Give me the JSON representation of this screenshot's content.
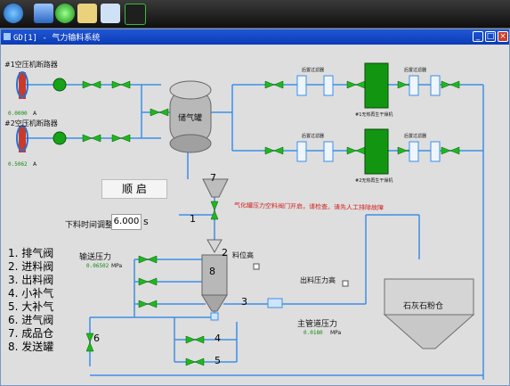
{
  "window": {
    "title": "GD[1] - 气力输料系统"
  },
  "compressors": [
    {
      "name": "#1空压机断路器",
      "value": "0.0000",
      "unit": "A"
    },
    {
      "name": "#2空压机断路器",
      "value": "0.5062",
      "unit": "A"
    }
  ],
  "tank_label": "储气罐",
  "filters": [
    "后置过滤器",
    "后置过滤器",
    "后置过滤器",
    "后置过滤器"
  ],
  "dryers": [
    "#1无热再生干燥机",
    "#2无热再生干燥机"
  ],
  "mode_button": "顺  启",
  "unload_time": {
    "label": "下料时间调整",
    "value": "6.000",
    "unit": "s"
  },
  "alarm_text": "气化罐压力空料阀门开启，请检查。请先人工排除故障",
  "material_high": "料位高",
  "outlet_pressure_high": "出料压力高",
  "conveying_pressure": {
    "label": "输送压力",
    "value": "0.06502",
    "unit": "MPa"
  },
  "main_pressure": {
    "label": "主管道压力",
    "value": "0.0180",
    "unit": "MPa"
  },
  "silo_label": "石灰石粉仓",
  "numbers": [
    "1",
    "2",
    "3",
    "4",
    "5",
    "6",
    "7",
    "8"
  ],
  "legend": [
    "1. 排气阀",
    "2. 进料阀",
    "3. 出料阀",
    "4. 小补气",
    "5. 大补气",
    "6. 进气阀",
    "7. 成品仓",
    "8. 发送罐"
  ]
}
